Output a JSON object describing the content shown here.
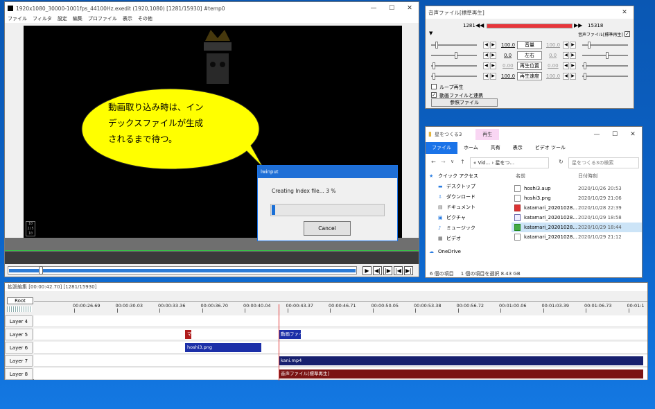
{
  "main": {
    "title": "1920x1080_30000-1001fps_44100Hz.exedit (1920,1080)  [1281/15930]  #temp0",
    "menu": [
      "ファイル",
      "フィルタ",
      "設定",
      "編集",
      "プロファイル",
      "表示",
      "その他"
    ],
    "frame_badge": "10 2/5 10"
  },
  "callout": {
    "text_line1": "動画取り込み時は、イン",
    "text_line2": "デックスファイルが生成",
    "text_line3": "されるまで待つ。",
    "fill_color": "#ffff00"
  },
  "lwinput": {
    "title": "lwinput",
    "message": "Creating Index file... 3 %",
    "progress": 0.03,
    "cancel_label": "Cancel"
  },
  "audio": {
    "title": "音声ファイル[標準再生]",
    "frame_start": "1281",
    "frame_end": "15318",
    "object_name": "音声ファイル[標準再生]",
    "params": [
      {
        "value": "100.0",
        "label": "音量",
        "value2": "100.0"
      },
      {
        "value": "0.0",
        "label": "左右",
        "value2": "0.0"
      },
      {
        "value": "0.00",
        "label": "再生位置",
        "value2": "0.00"
      },
      {
        "value": "100.0",
        "label": "再生速度",
        "value2": "100.0"
      }
    ],
    "loop_label": "ループ再生",
    "link_label": "動画ファイルと連携",
    "browse_label": "参照ファイル"
  },
  "explorer": {
    "title": "星をつくる3",
    "context_tab": "再生",
    "tabs": [
      "ファイル",
      "ホーム",
      "共有",
      "表示",
      "ビデオ ツール"
    ],
    "address": "« Vid... › 星をつ...",
    "search_placeholder": "星をつくる3の検索",
    "nav": [
      "クイック アクセス",
      "デスクトップ",
      "ダウンロード",
      "ドキュメント",
      "ピクチャ",
      "ミュージック",
      "ビデオ",
      "OneDrive"
    ],
    "col_name": "名前",
    "col_date": "日付時刻",
    "files": [
      {
        "name": "hoshi3.aup",
        "date": "2020/10/26 20:53"
      },
      {
        "name": "hoshi3.png",
        "date": "2020/10/29 21:06"
      },
      {
        "name": "katamari_20201028...",
        "date": "2020/10/28 22:39"
      },
      {
        "name": "katamari_20201028...",
        "date": "2020/10/29 18:58"
      },
      {
        "name": "katamari_20201028...",
        "date": "2020/10/29 18:44"
      },
      {
        "name": "katamari_20201028...",
        "date": "2020/10/29 21:12"
      }
    ],
    "status_count": "6 個の項目",
    "status_selected": "1 個の項目を選択  8.43 GB"
  },
  "timeline": {
    "title": "拡張編集 [00:00:42.70] [1281/15930]",
    "root_label": "Root",
    "ticks": [
      "00:00:26.69",
      "00:00:30.03",
      "00:00:33.36",
      "00:00:36.70",
      "00:00:40.04",
      "00:00:43.37",
      "00:00:46.71",
      "00:00:50.05",
      "00:00:53.38",
      "00:00:56.72",
      "00:01:00.06",
      "00:01:03.39",
      "00:01:06.73",
      "00:01:1"
    ],
    "layers": [
      "Layer 4",
      "Layer 5",
      "Layer 6",
      "Layer 7",
      "Layer 8"
    ],
    "clip_l5a": "マ",
    "clip_l5b": "動画ファイ",
    "clip_l6": "hoshi3.png",
    "clip_l7": "kani.mp4",
    "clip_l8": "音声ファイル[標準再生]"
  }
}
